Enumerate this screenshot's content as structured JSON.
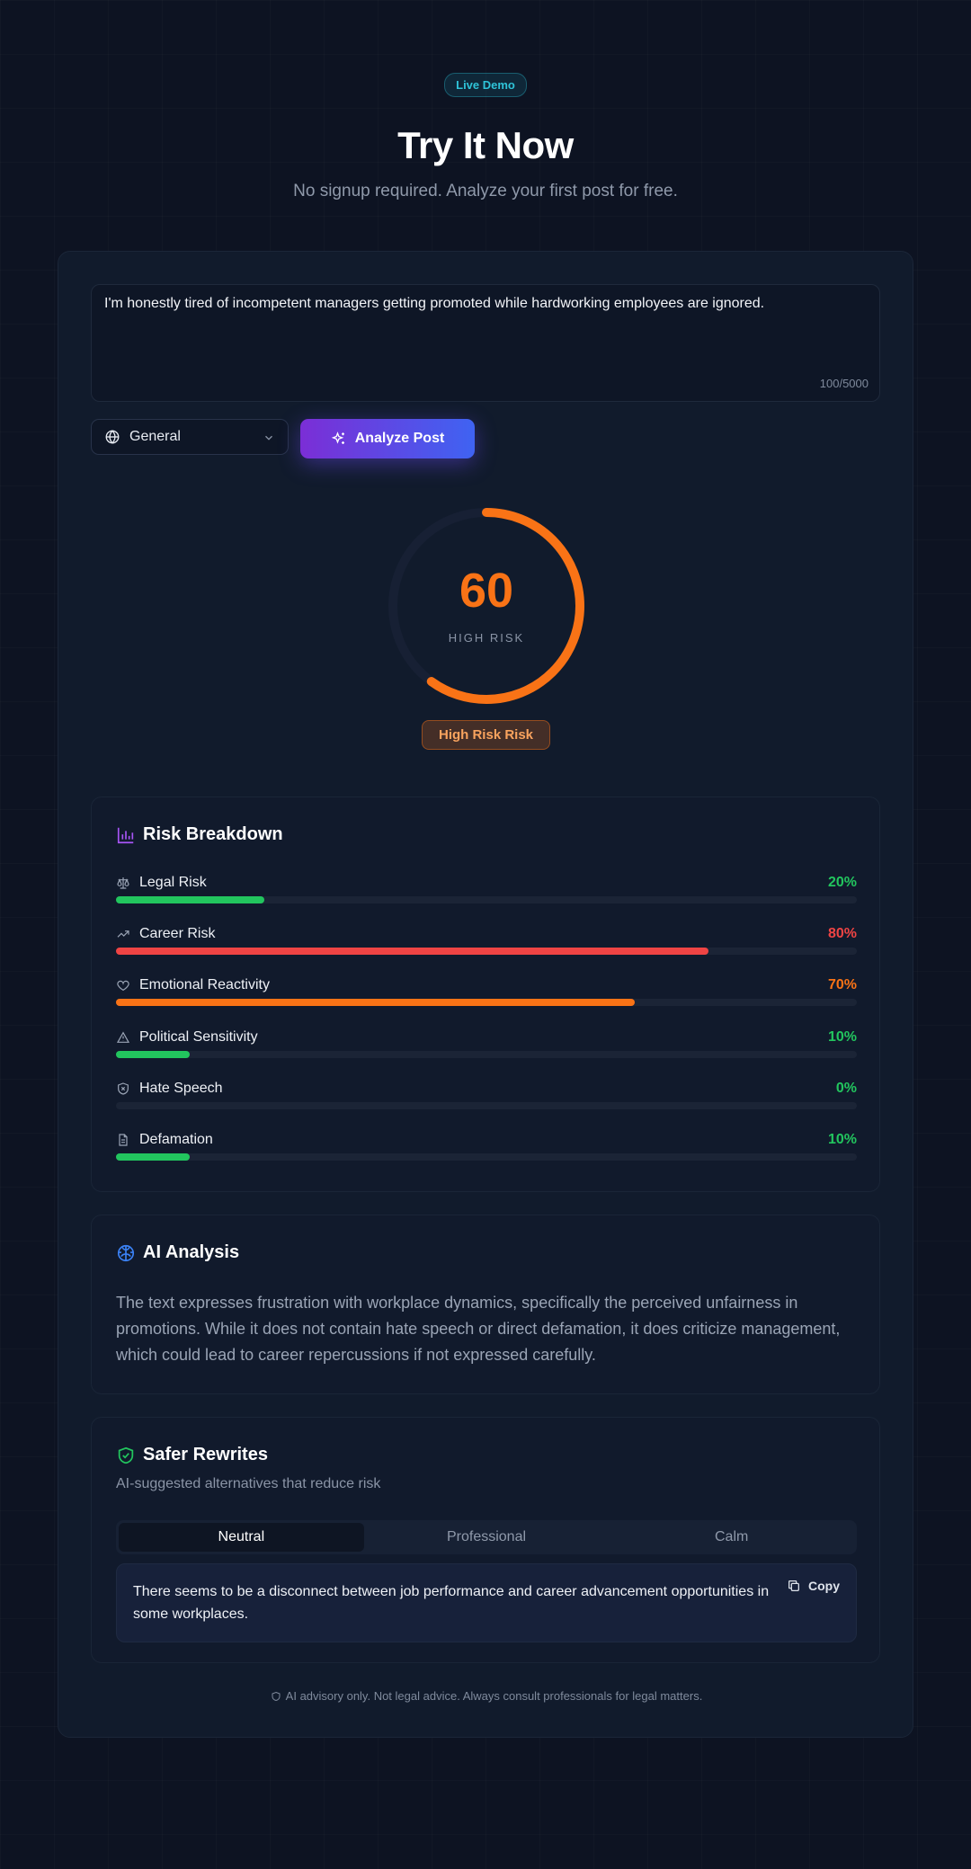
{
  "header": {
    "badge": "Live Demo",
    "title": "Try It Now",
    "subtitle": "No signup required. Analyze your first post for free."
  },
  "input": {
    "text": "I'm honestly tired of incompetent managers getting promoted while hardworking employees are ignored.",
    "counter": "100/5000"
  },
  "platform_select": {
    "value": "General"
  },
  "analyze_button": {
    "label": "Analyze Post"
  },
  "score": {
    "value": "60",
    "fraction": 0.6,
    "label": "HIGH RISK",
    "pill": "High Risk Risk",
    "color": "#f97316"
  },
  "breakdown": {
    "title": "Risk Breakdown",
    "items": [
      {
        "name": "Legal Risk",
        "pct": "20%",
        "value": 20,
        "color": "#22c55e",
        "icon": "scale-icon"
      },
      {
        "name": "Career Risk",
        "pct": "80%",
        "value": 80,
        "color": "#ef4444",
        "icon": "trending-up-icon"
      },
      {
        "name": "Emotional Reactivity",
        "pct": "70%",
        "value": 70,
        "color": "#f97316",
        "icon": "heart-icon"
      },
      {
        "name": "Political Sensitivity",
        "pct": "10%",
        "value": 10,
        "color": "#22c55e",
        "icon": "warning-triangle-icon"
      },
      {
        "name": "Hate Speech",
        "pct": "0%",
        "value": 0,
        "color": "#22c55e",
        "icon": "shield-x-icon"
      },
      {
        "name": "Defamation",
        "pct": "10%",
        "value": 10,
        "color": "#22c55e",
        "icon": "document-icon"
      }
    ]
  },
  "analysis": {
    "title": "AI Analysis",
    "text": "The text expresses frustration with workplace dynamics, specifically the perceived unfairness in promotions. While it does not contain hate speech or direct defamation, it does criticize management, which could lead to career repercussions if not expressed carefully."
  },
  "rewrites": {
    "title": "Safer Rewrites",
    "subtitle": "AI-suggested alternatives that reduce risk",
    "tabs": [
      "Neutral",
      "Professional",
      "Calm"
    ],
    "active_tab": 0,
    "text": "There seems to be a disconnect between job performance and career advancement opportunities in some workplaces.",
    "copy_label": "Copy"
  },
  "disclaimer": "AI advisory only. Not legal advice. Always consult professionals for legal matters."
}
